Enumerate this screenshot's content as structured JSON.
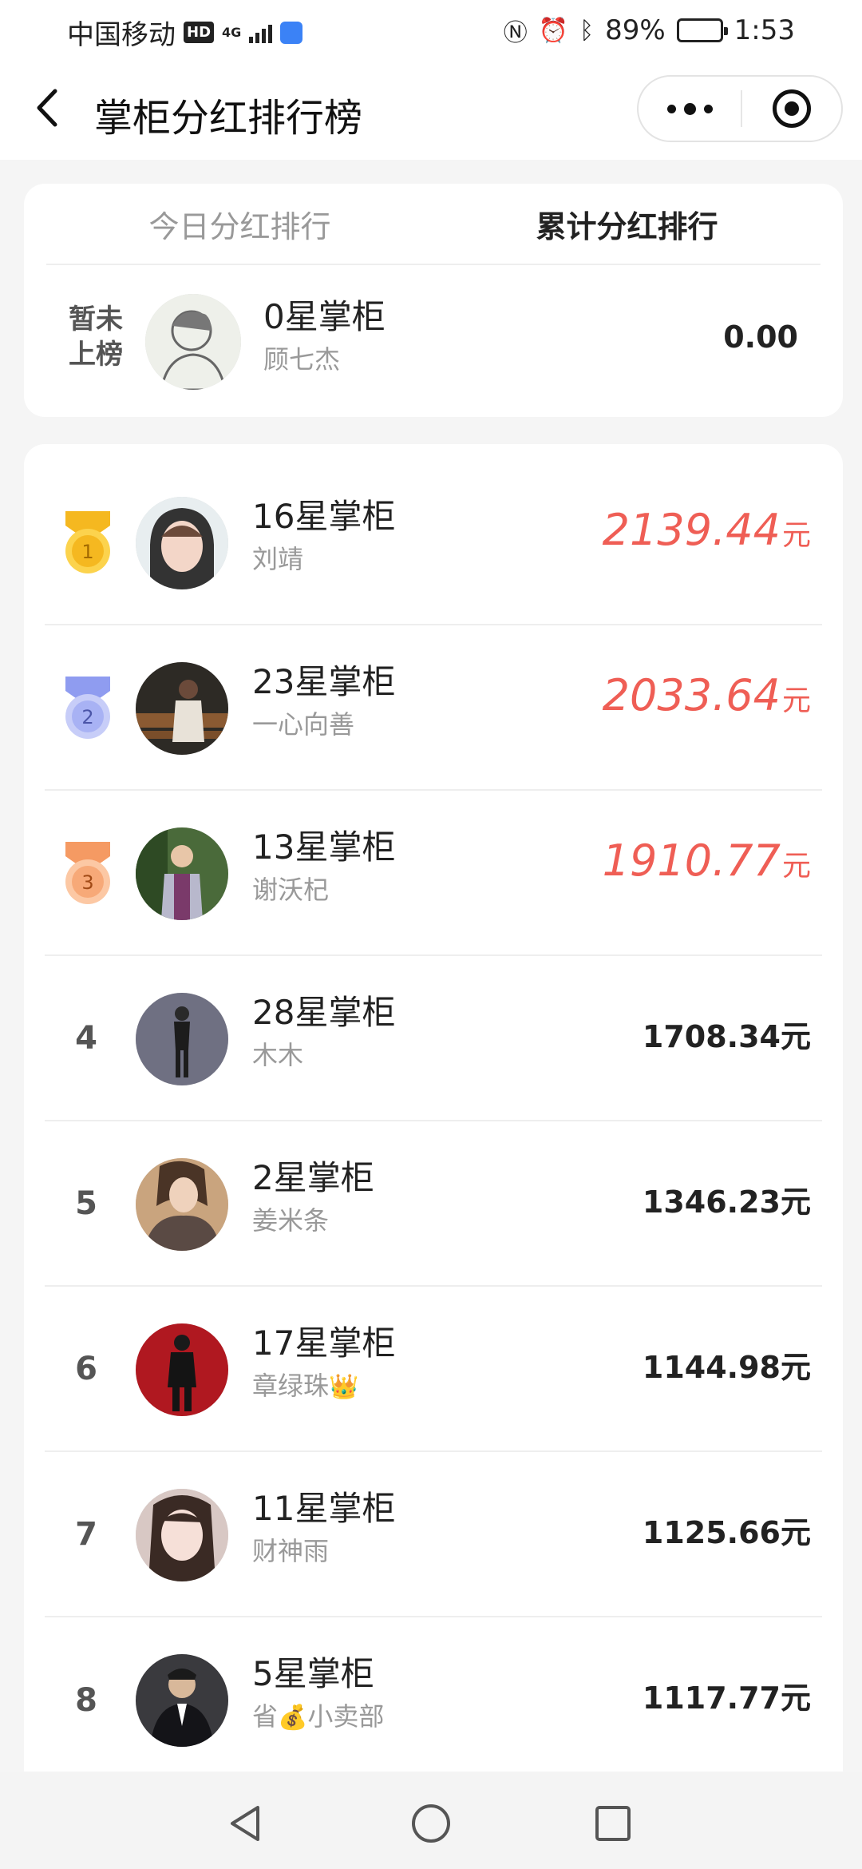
{
  "status_bar": {
    "carrier": "中国移动",
    "hd_label": "HD",
    "network_label": "4G",
    "battery_text": "89%",
    "battery_level": 0.89,
    "time": "1:53",
    "icons": [
      "hd-icon",
      "signal-icon",
      "app-notification-icon",
      "nfc-icon",
      "alarm-icon",
      "bluetooth-icon",
      "battery-icon"
    ]
  },
  "nav": {
    "title": "掌柜分红排行榜",
    "back_icon": "chevron-left-icon",
    "more_icon": "more-dots-icon",
    "close_icon": "target-close-icon"
  },
  "tabs": [
    {
      "label": "今日分红排行",
      "active": false
    },
    {
      "label": "累计分红排行",
      "active": true
    }
  ],
  "my_rank": {
    "rank_label": "暂未上榜",
    "title": "0星掌柜",
    "name": "顾七杰",
    "amount": "0.00"
  },
  "leaders": [
    {
      "rank": "1",
      "title": "16星掌柜",
      "name": "刘靖",
      "amount": "2139.44",
      "unit": "元",
      "medal": "gold-medal-icon"
    },
    {
      "rank": "2",
      "title": "23星掌柜",
      "name": "一心向善",
      "amount": "2033.64",
      "unit": "元",
      "medal": "silver-medal-icon"
    },
    {
      "rank": "3",
      "title": "13星掌柜",
      "name": "谢沃杞",
      "amount": "1910.77",
      "unit": "元",
      "medal": "bronze-medal-icon"
    },
    {
      "rank": "4",
      "title": "28星掌柜",
      "name": "木木",
      "amount": "1708.34元"
    },
    {
      "rank": "5",
      "title": "2星掌柜",
      "name": "姜米条",
      "amount": "1346.23元"
    },
    {
      "rank": "6",
      "title": "17星掌柜",
      "name": "章绿珠",
      "name_emoji": "👑",
      "amount": "1144.98元"
    },
    {
      "rank": "7",
      "title": "11星掌柜",
      "name": "财神雨",
      "amount": "1125.66元"
    },
    {
      "rank": "8",
      "title": "5星掌柜",
      "name_prefix": "省",
      "name_emoji": "💰",
      "name": "小卖部",
      "amount": "1117.77元"
    }
  ],
  "colors": {
    "accent_red": "#ef5e55",
    "gold": "#f5b820",
    "silver": "#8f9cf0",
    "bronze": "#f59a63"
  },
  "system_nav": {
    "back_icon": "triangle-back-icon",
    "home_icon": "circle-home-icon",
    "recent_icon": "square-recent-icon"
  }
}
